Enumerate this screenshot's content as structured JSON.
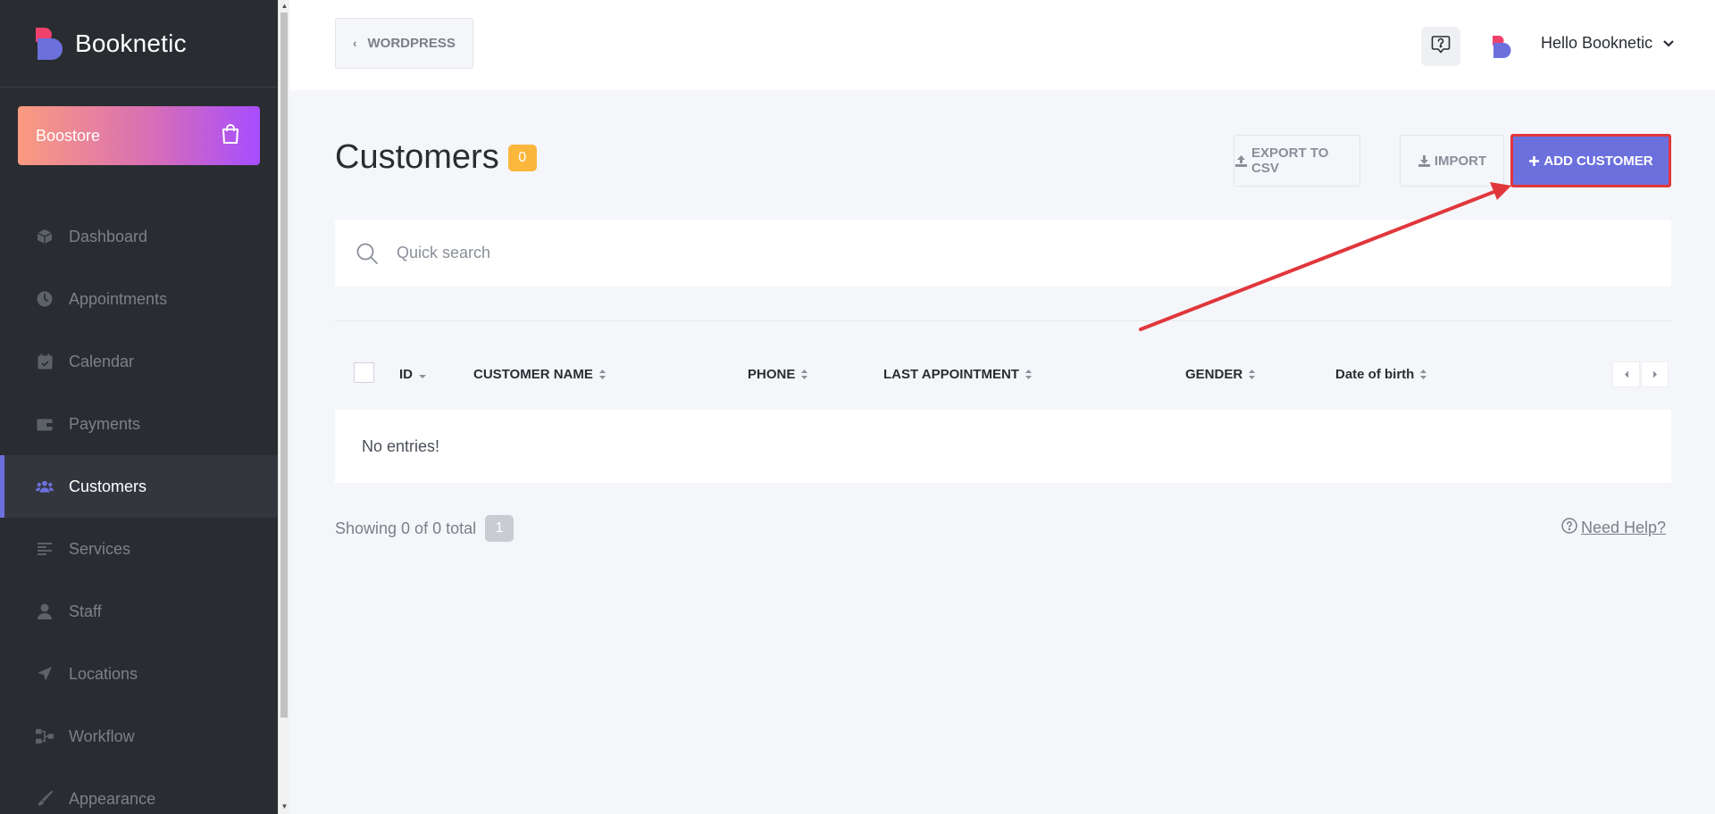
{
  "app": {
    "brand_name": "Booknetic",
    "boostore_label": "Boostore"
  },
  "sidebar": {
    "items": [
      {
        "label": "Dashboard",
        "icon": "cube-icon"
      },
      {
        "label": "Appointments",
        "icon": "clock-icon"
      },
      {
        "label": "Calendar",
        "icon": "calendar-check-icon"
      },
      {
        "label": "Payments",
        "icon": "wallet-icon"
      },
      {
        "label": "Customers",
        "icon": "users-icon",
        "active": true
      },
      {
        "label": "Services",
        "icon": "list-icon"
      },
      {
        "label": "Staff",
        "icon": "user-icon"
      },
      {
        "label": "Locations",
        "icon": "location-arrow-icon"
      },
      {
        "label": "Workflow",
        "icon": "sitemap-icon"
      },
      {
        "label": "Appearance",
        "icon": "brush-icon"
      }
    ]
  },
  "topbar": {
    "back_label": "WORDPRESS",
    "user_greeting": "Hello Booknetic"
  },
  "page": {
    "title": "Customers",
    "count": "0",
    "export_label": "EXPORT TO CSV",
    "import_label": "IMPORT",
    "add_label": "ADD CUSTOMER"
  },
  "search": {
    "placeholder": "Quick search",
    "value": ""
  },
  "table": {
    "columns": [
      "ID",
      "CUSTOMER NAME",
      "PHONE",
      "LAST APPOINTMENT",
      "GENDER",
      "Date of birth"
    ],
    "empty_text": "No entries!"
  },
  "footer": {
    "showing": "Showing 0 of 0 total",
    "current_page": "1",
    "help_label": "Need Help?"
  },
  "colors": {
    "sidebar_bg": "#292d32",
    "accent": "#6c70dc",
    "badge": "#fbb73c",
    "annotation": "#e0373c"
  }
}
